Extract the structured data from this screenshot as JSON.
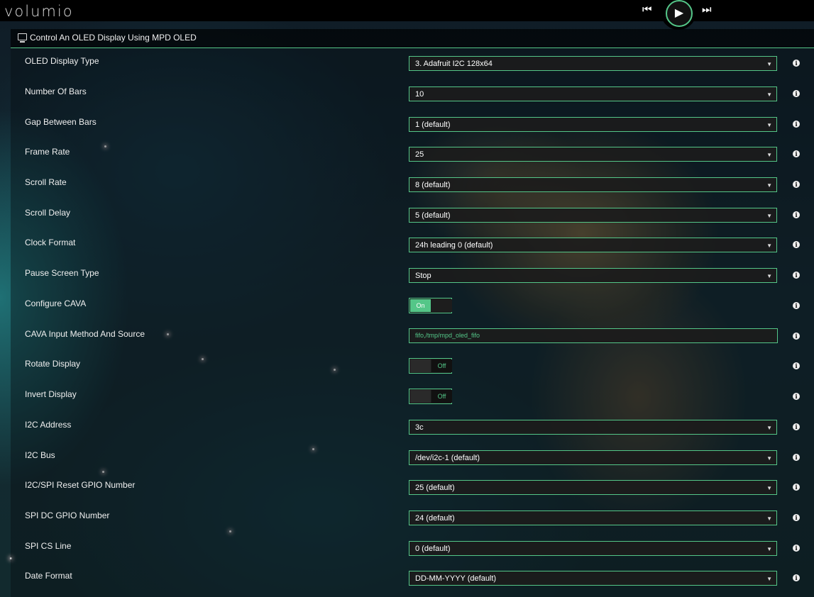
{
  "app": {
    "logo": "volumio"
  },
  "player": {
    "prev_icon": "skip-previous-icon",
    "play_icon": "play-icon",
    "next_icon": "skip-next-icon",
    "prev_glyph": "⏮",
    "play_glyph": "▶",
    "next_glyph": "⏭"
  },
  "panel": {
    "title": "Control An OLED Display Using MPD OLED"
  },
  "settings": {
    "oled_display_type": {
      "label": "OLED Display Type",
      "value": "3. Adafruit I2C 128x64"
    },
    "number_of_bars": {
      "label": "Number Of Bars",
      "value": "10"
    },
    "gap_between_bars": {
      "label": "Gap Between Bars",
      "value": "1 (default)"
    },
    "frame_rate": {
      "label": "Frame Rate",
      "value": "25"
    },
    "scroll_rate": {
      "label": "Scroll Rate",
      "value": "8 (default)"
    },
    "scroll_delay": {
      "label": "Scroll Delay",
      "value": "5 (default)"
    },
    "clock_format": {
      "label": "Clock Format",
      "value": "24h leading 0 (default)"
    },
    "pause_screen_type": {
      "label": "Pause Screen Type",
      "value": "Stop"
    },
    "configure_cava": {
      "label": "Configure CAVA",
      "value": "On"
    },
    "cava_input": {
      "label": "CAVA Input Method And Source",
      "value": "fifo,/tmp/mpd_oled_fifo"
    },
    "rotate_display": {
      "label": "Rotate Display",
      "value": "Off"
    },
    "invert_display": {
      "label": "Invert Display",
      "value": "Off"
    },
    "i2c_address": {
      "label": "I2C Address",
      "value": "3c"
    },
    "i2c_bus": {
      "label": "I2C Bus",
      "value": "/dev/i2c-1 (default)"
    },
    "reset_gpio": {
      "label": "I2C/SPI Reset GPIO Number",
      "value": "25 (default)"
    },
    "spi_dc_gpio": {
      "label": "SPI DC GPIO Number",
      "value": "24 (default)"
    },
    "spi_cs_line": {
      "label": "SPI CS Line",
      "value": "0 (default)"
    },
    "date_format": {
      "label": "Date Format",
      "value": "DD-MM-YYYY (default)"
    }
  },
  "colors": {
    "accent": "#54c688",
    "topbar": "#000000"
  }
}
